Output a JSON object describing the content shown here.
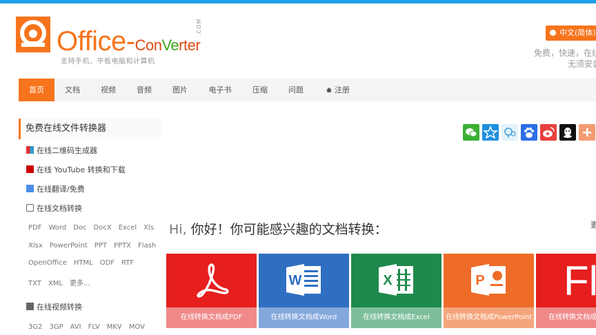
{
  "header": {
    "logo_word": "Office-",
    "logo_conv_a": "Con",
    "logo_conv_b": "Ve",
    "logo_conv_c": "rter",
    "logo_com": ".COM",
    "logo_sub": "支持手机、平板电脑和计算机",
    "lang": "中文(简体)",
    "tagline1": "免费，快速，在线",
    "tagline2": "无须安装"
  },
  "nav": [
    {
      "label": "首页"
    },
    {
      "label": "文档"
    },
    {
      "label": "视频"
    },
    {
      "label": "音频"
    },
    {
      "label": "图片"
    },
    {
      "label": "电子书"
    },
    {
      "label": "压缩"
    },
    {
      "label": "问题"
    },
    {
      "label": "注册"
    }
  ],
  "sidebar": {
    "title": "免费在线文件转换器",
    "items": [
      {
        "label": "在线二维码生成器",
        "icon": "qr-icon"
      },
      {
        "label": "在线 YouTube 转换和下载",
        "icon": "youtube-icon"
      },
      {
        "label": "在线翻译/免费",
        "icon": "translate-icon"
      },
      {
        "label": "在线文档转换",
        "icon": "document-icon"
      },
      {
        "label": "在线视频转换",
        "icon": "video-icon"
      }
    ],
    "doc_formats": [
      [
        "PDF",
        "Word",
        "Doc",
        "DocX",
        "Excel",
        "Xls"
      ],
      [
        "Xlsx",
        "PowerPoint",
        "PPT",
        "PPTX",
        "Flash"
      ],
      [
        "OpenOffice",
        "HTML",
        "ODF",
        "RTF"
      ],
      [
        "TXT",
        "XML",
        "更多..."
      ]
    ],
    "video_formats": [
      "3G2",
      "3GP",
      "AVI",
      "FLV",
      "MKV",
      "MOV"
    ]
  },
  "share_icons": [
    {
      "name": "wechat-icon",
      "color": "#3cb034"
    },
    {
      "name": "star-icon",
      "color": "#1f8fe0"
    },
    {
      "name": "pengyou-icon",
      "color": "#e4f2fb"
    },
    {
      "name": "baidu-icon",
      "color": "#2c6ee8"
    },
    {
      "name": "weibo-icon",
      "color": "#e8413d"
    },
    {
      "name": "qq-icon",
      "color": "#111111"
    },
    {
      "name": "plus-icon",
      "color": "#f29c72"
    }
  ],
  "main": {
    "greeting_hi": "Hi,",
    "greeting_rest": " 你好！你可能感兴趣的文档转换：",
    "more": "更",
    "cards": [
      {
        "label": "在线转换文档成PDF",
        "color": "#e61e1e",
        "caption_color": "#f08a8a",
        "icon": "pdf-icon"
      },
      {
        "label": "在线转换文档成Word",
        "color": "#2f6fc2",
        "caption_color": "#84a8dc",
        "icon": "word-icon"
      },
      {
        "label": "在线转换文档成Excel",
        "color": "#1e8a4c",
        "caption_color": "#7dbf9a",
        "icon": "excel-icon"
      },
      {
        "label": "在线转换文档成PowerPoint",
        "color": "#ef6c28",
        "caption_color": "#f5a57b",
        "icon": "powerpoint-icon"
      },
      {
        "label": "在线转换文档成",
        "color": "#e61e1e",
        "caption_color": "#f08a8a",
        "icon": "flash-icon"
      }
    ]
  },
  "colors": {
    "accent": "#f7741c",
    "topbar": "#1fa0e6"
  }
}
